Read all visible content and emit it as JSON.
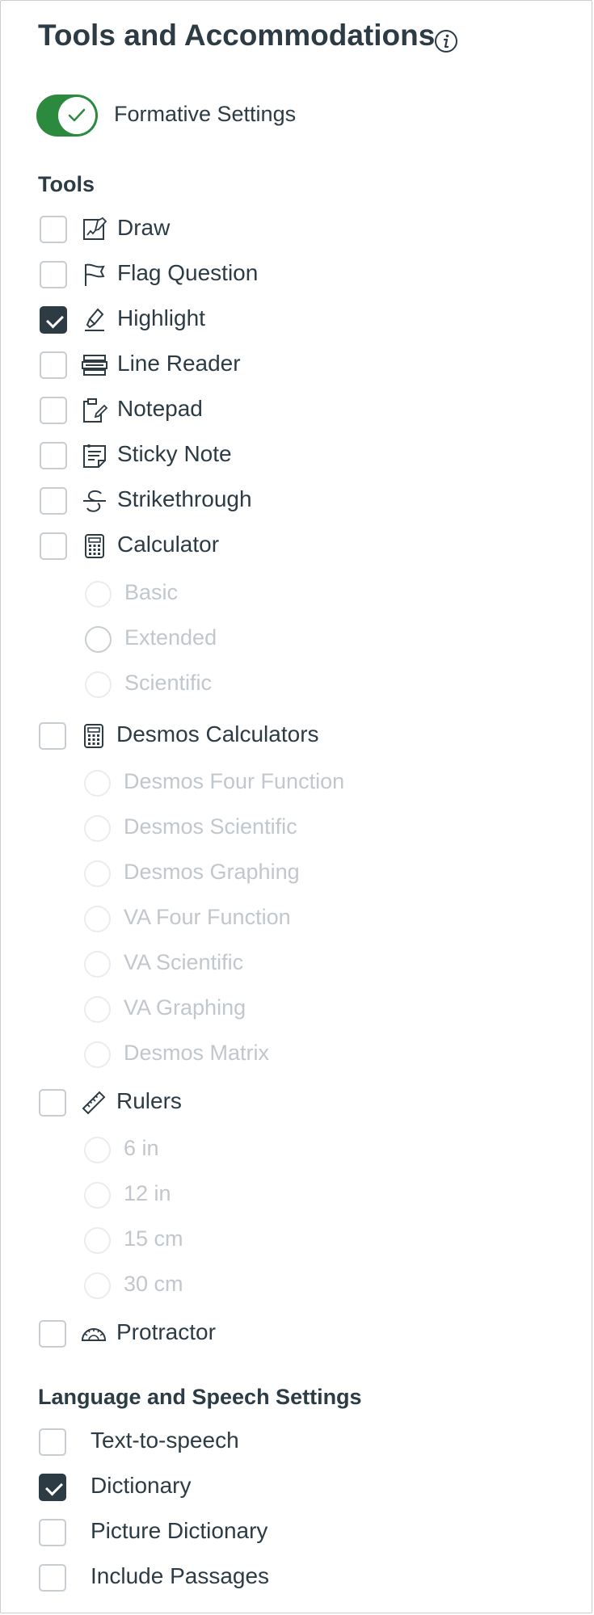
{
  "title": "Tools and Accommodations",
  "formative_toggle": {
    "label": "Formative Settings",
    "on": true
  },
  "tools_heading": "Tools",
  "tools": [
    {
      "label": "Draw",
      "checked": false,
      "icon": "draw-icon"
    },
    {
      "label": "Flag Question",
      "checked": false,
      "icon": "flag-icon"
    },
    {
      "label": "Highlight",
      "checked": true,
      "icon": "highlighter-icon"
    },
    {
      "label": "Line Reader",
      "checked": false,
      "icon": "line-reader-icon"
    },
    {
      "label": "Notepad",
      "checked": false,
      "icon": "notepad-icon"
    },
    {
      "label": "Sticky Note",
      "checked": false,
      "icon": "sticky-note-icon"
    },
    {
      "label": "Strikethrough",
      "checked": false,
      "icon": "strikethrough-icon"
    },
    {
      "label": "Calculator",
      "checked": false,
      "icon": "calculator-icon"
    }
  ],
  "calculator_options": [
    "Basic",
    "Extended",
    "Scientific"
  ],
  "desmos": {
    "label": "Desmos Calculators",
    "checked": false,
    "icon": "desmos-calculator-icon"
  },
  "desmos_options": [
    "Desmos Four Function",
    "Desmos Scientific",
    "Desmos Graphing",
    "VA Four Function",
    "VA Scientific",
    "VA Graphing",
    "Desmos Matrix"
  ],
  "rulers": {
    "label": "Rulers",
    "checked": false,
    "icon": "ruler-icon"
  },
  "ruler_options": [
    "6 in",
    "12 in",
    "15 cm",
    "30 cm"
  ],
  "protractor": {
    "label": "Protractor",
    "checked": false,
    "icon": "protractor-icon"
  },
  "language_heading": "Language and Speech Settings",
  "language_items": [
    {
      "label": "Text-to-speech",
      "checked": false
    },
    {
      "label": "Dictionary",
      "checked": true
    },
    {
      "label": "Picture Dictionary",
      "checked": false
    },
    {
      "label": "Include Passages",
      "checked": false
    }
  ],
  "colors": {
    "text": "#2d3b45",
    "toggle_on": "#2b8a3e",
    "disabled_text": "#c1c7cc",
    "border": "#c7cdd1"
  }
}
